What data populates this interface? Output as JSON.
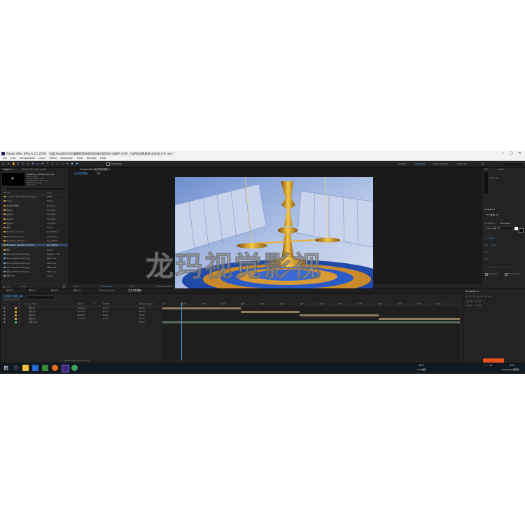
{
  "window": {
    "title": "Adobe After Effects CC 2018 - \\U盘(Seo(D)\\2020唐鹰视频剪辑\\再剪辑分镜\\004 剪辑片头\\45 工程AE剪辑\\原剪\\总剪\\总文件.aep *",
    "controls": [
      "─",
      "□",
      "✕"
    ]
  },
  "menu": [
    "File",
    "Edit",
    "Composition",
    "Layer",
    "Effect",
    "Animation",
    "View",
    "Window",
    "Help"
  ],
  "toolbar": {
    "snapping_label": "Snapping",
    "workspaces": [
      "Default",
      "Standard",
      "Small Screen",
      "Libraries"
    ],
    "active_workspace": "Standard",
    "search_placeholder": "Search Help"
  },
  "project_panel": {
    "tabs": [
      "Project ≡",
      "Effect Controls (none)"
    ],
    "preview_name": "Windows _shutter_01.mov",
    "preview_lines": [
      "used 1 time",
      "1920 x 1080 (1.00)",
      "Δ 0;00;04;09, 29.97 fps",
      "Millions of Colors",
      "Animation"
    ],
    "search_placeholder": "ρ▾",
    "columns": [
      "Name",
      "Type"
    ],
    "items": [
      {
        "name": "YouTuzh_2019.5b(1)400.mp4",
        "type": "MPEG",
        "color": "#c8a040"
      },
      {
        "name": "Solids",
        "type": "Folder",
        "color": "#c8a040"
      },
      {
        "name": "总文件剪辑版",
        "type": "Compos",
        "color": "#c8a040"
      },
      {
        "name": "镜头01",
        "type": "Compos",
        "color": "#c8a040"
      },
      {
        "name": "镜头02",
        "type": "Compos",
        "color": "#c8a040"
      },
      {
        "name": "镜头03",
        "type": "Compos",
        "color": "#c8a040"
      },
      {
        "name": "镜头04",
        "type": "Compos",
        "color": "#c8a040"
      },
      {
        "name": "素材",
        "type": "Folder",
        "color": "#c8a040"
      },
      {
        "name": "Windows_01.mov",
        "type": "QuickTime",
        "color": "#c8a040"
      },
      {
        "name": "Windows_02.mov",
        "type": "QuickTime",
        "color": "#c8a040"
      },
      {
        "name": "Windows_03.mov",
        "type": "QuickTime",
        "color": "#c8a040"
      },
      {
        "name": "Windows _shutter_01.mov",
        "type": "QuickTime",
        "color": "#c8a040",
        "selected": true
      },
      {
        "name": "图片",
        "type": "Folder",
        "color": "#c8a040"
      },
      {
        "name": "B-01-a[0000-0120].jpg",
        "type": "Targa S...ce",
        "color": "#7fa0c0"
      },
      {
        "name": "B-02-a[0000-0120].jpg",
        "type": "PNG Seq",
        "color": "#7fa0c0"
      },
      {
        "name": "B-03-a[0000-0120].jpg",
        "type": "PNG Seq",
        "color": "#7fa0c0"
      },
      {
        "name": "B-04-a[0000-0120].jpg",
        "type": "PNG Seq",
        "color": "#7fa0c0"
      },
      {
        "name": "镜头-a[0000-0120].jpg",
        "type": "PNG Seq",
        "color": "#7fa0c0"
      },
      {
        "name": "音乐.wav",
        "type": "Audio",
        "color": "#7fa0c0"
      }
    ],
    "footer_bpc": "8 bpc"
  },
  "composition_panel": {
    "tab": "Composition 总文件剪辑版 ≡",
    "subtabs": [
      "总文件剪辑版",
      "镜头"
    ],
    "footer": {
      "zoom": "50%",
      "time": "0;00;00;24",
      "resolution": "Full",
      "camera": "Active Camera",
      "views": "1 View"
    }
  },
  "right_panels": {
    "top_tabs": [
      "Info",
      "Audio"
    ],
    "libraries": "Libraries",
    "preview_title": "Preview ≡",
    "paragraph_tabs": [
      "Paragraph",
      "Character"
    ],
    "font_name": "Adobe 黑体 Std",
    "font_size": "36 px",
    "tracking": "0 px",
    "ligatures": "Ligatures",
    "hindi_digits": "Hindi Digits"
  },
  "timeline": {
    "tabs": [
      "镜头01",
      "镜头02",
      "镜头03",
      "镜头04",
      "Render Queue",
      "总文件剪辑版"
    ],
    "timecode": "0;00;00;24",
    "frame_info": "00024 (29.97 fps)",
    "columns": [
      "#",
      "Source Name",
      "Mode",
      "T",
      "TrkMat",
      "Parent & Link"
    ],
    "layers": [
      {
        "num": "1",
        "name": "镜头01",
        "mode": "Normal",
        "trkmat": "None",
        "parent": "None",
        "color": "#c8a040"
      },
      {
        "num": "2",
        "name": "镜头02",
        "mode": "Normal",
        "trkmat": "None",
        "parent": "None",
        "color": "#c8a040"
      },
      {
        "num": "3",
        "name": "镜头03",
        "mode": "Normal",
        "trkmat": "None",
        "parent": "None",
        "color": "#c8a040"
      },
      {
        "num": "4",
        "name": "镜头04",
        "mode": "Normal",
        "trkmat": "None",
        "parent": "None",
        "color": "#c8a040"
      },
      {
        "num": "5",
        "name": "音乐.wav",
        "mode": "",
        "trkmat": "",
        "parent": "None",
        "color": "#4cb04c"
      }
    ],
    "ruler": [
      "0f",
      "00f",
      "10f",
      "20f",
      "00f",
      "10f",
      "20f",
      "00f",
      "10f",
      "20f",
      "00f",
      "10f",
      "20f",
      "00f",
      "10f"
    ],
    "toggle_label": "Toggle Switches / Modes",
    "paragraph_title": "Paragraph ≡"
  },
  "watermark": "龙玛视觉影视",
  "taskbar": {
    "temperature": "32℃",
    "cpu_label": "CPU温度",
    "time": "8:24",
    "date": "2020/4/30 星期四"
  }
}
